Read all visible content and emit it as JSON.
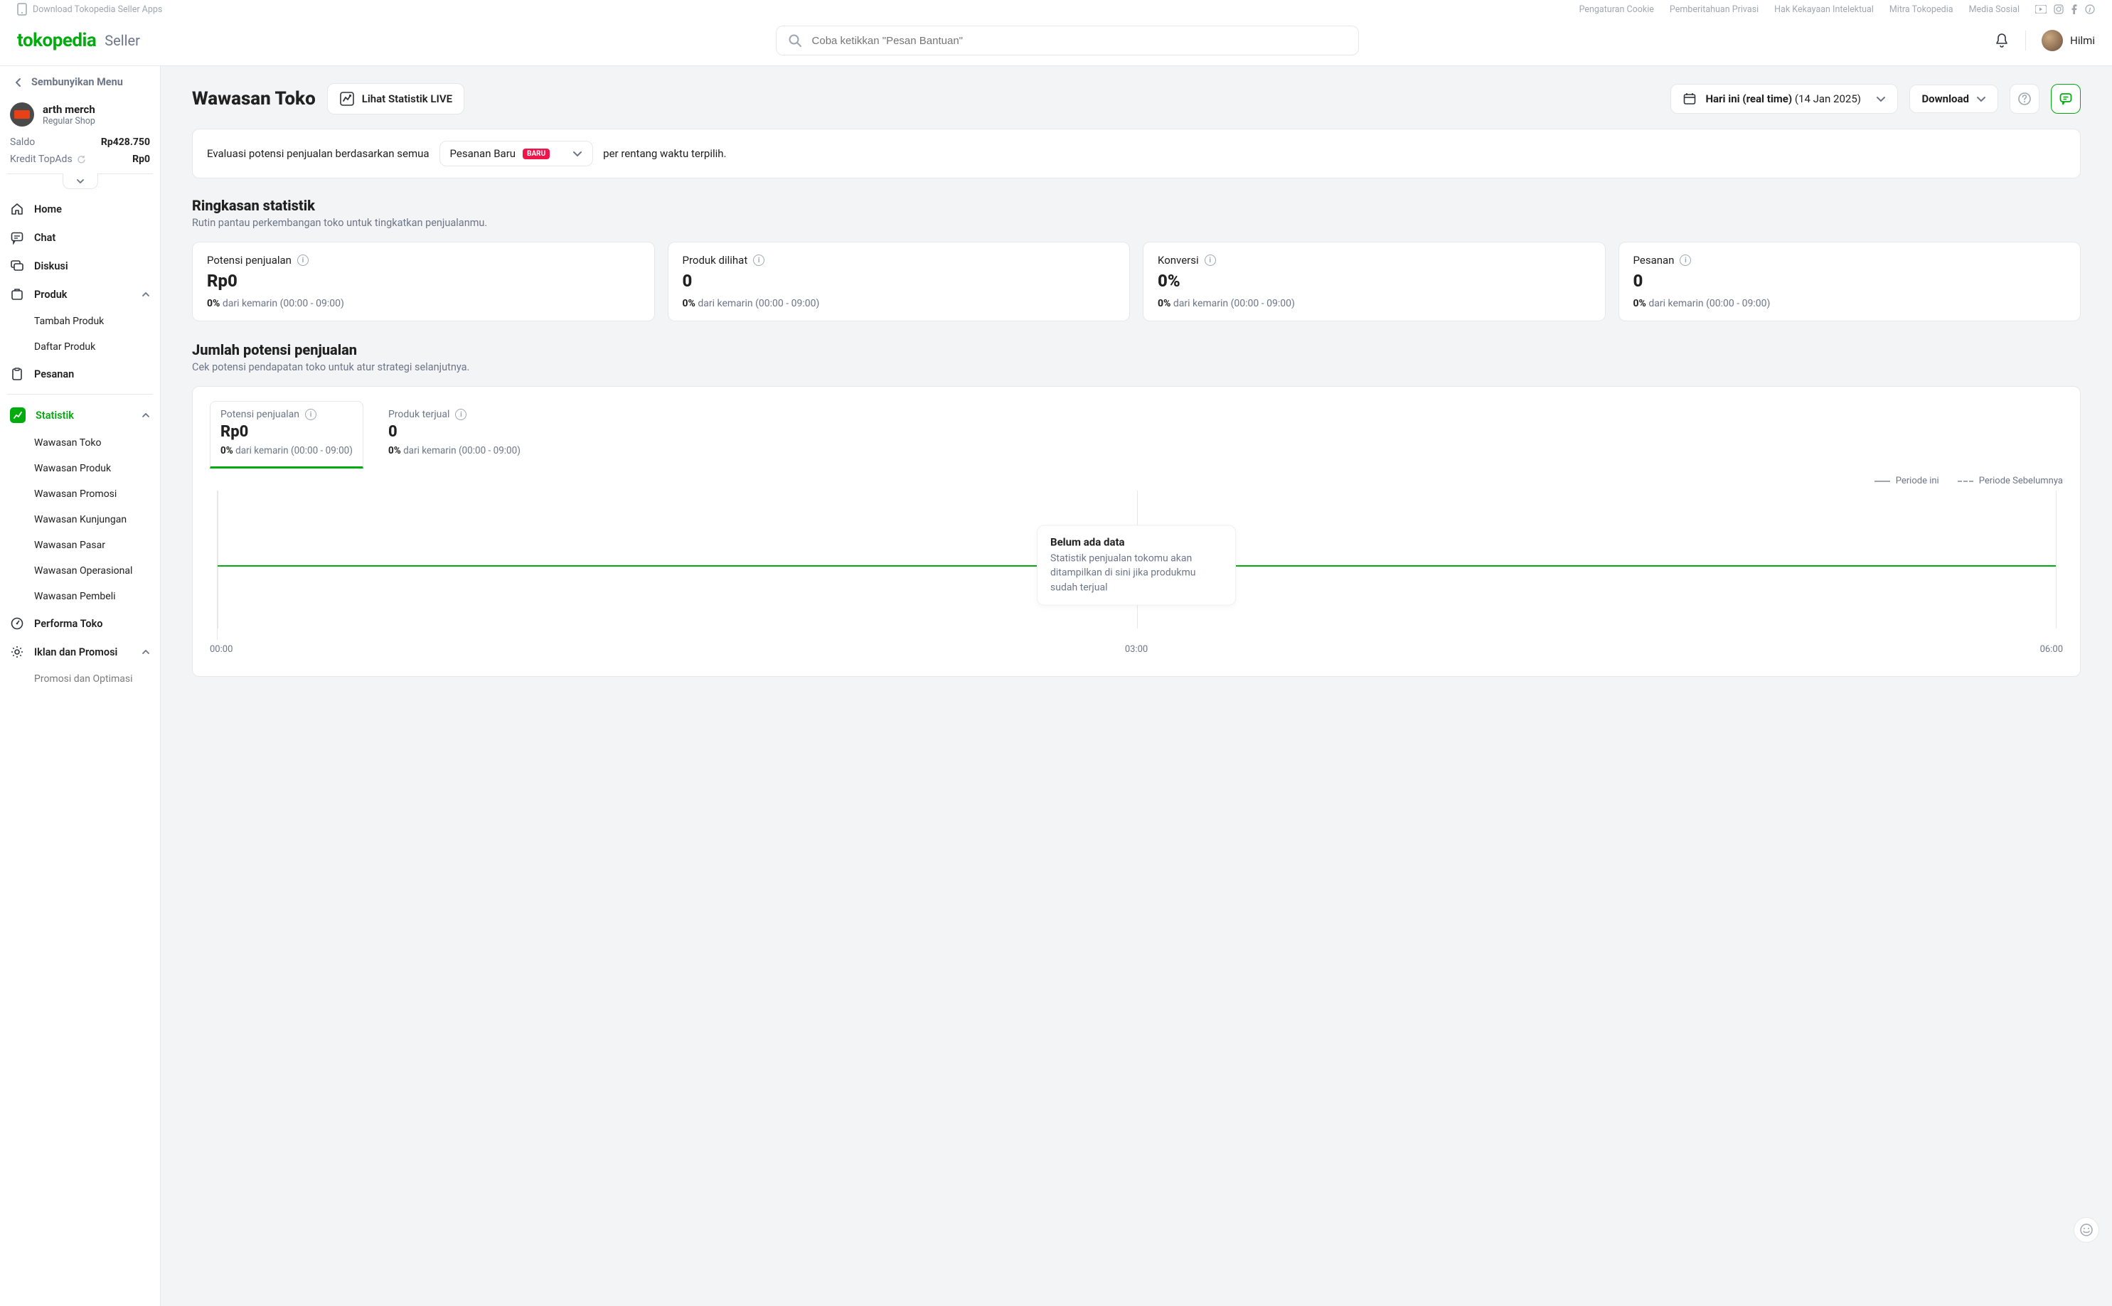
{
  "topbar": {
    "download": "Download Tokopedia Seller Apps",
    "links": [
      "Pengaturan Cookie",
      "Pemberitahuan Privasi",
      "Hak Kekayaan Intelektual",
      "Mitra Tokopedia",
      "Media Sosial"
    ]
  },
  "header": {
    "logo": "tokopedia",
    "logo_seller": "Seller",
    "search_placeholder": "Coba ketikkan \"Pesan Bantuan\"",
    "user_name": "Hilmi"
  },
  "sidebar": {
    "hide_menu": "Sembunyikan Menu",
    "shop_name": "arth merch",
    "shop_type": "Regular Shop",
    "saldo_label": "Saldo",
    "saldo_value": "Rp428.750",
    "kredit_label": "Kredit TopAds",
    "kredit_value": "Rp0",
    "items": {
      "home": "Home",
      "chat": "Chat",
      "diskusi": "Diskusi",
      "produk": "Produk",
      "tambah_produk": "Tambah Produk",
      "daftar_produk": "Daftar Produk",
      "pesanan": "Pesanan",
      "statistik": "Statistik",
      "wawasan_toko": "Wawasan Toko",
      "wawasan_produk": "Wawasan Produk",
      "wawasan_promosi": "Wawasan Promosi",
      "wawasan_kunjungan": "Wawasan Kunjungan",
      "wawasan_pasar": "Wawasan Pasar",
      "wawasan_operasional": "Wawasan Operasional",
      "wawasan_pembeli": "Wawasan Pembeli",
      "performa_toko": "Performa Toko",
      "iklan_promosi": "Iklan dan Promosi",
      "promosi_optimasi": "Promosi dan Optimasi"
    }
  },
  "page": {
    "title": "Wawasan Toko",
    "live_label": "Lihat Statistik LIVE",
    "date_prefix": "Hari ini (real time)",
    "date_value": "(14 Jan 2025)",
    "download": "Download",
    "eval": {
      "pre": "Evaluasi potensi penjualan berdasarkan semua",
      "select": "Pesanan Baru",
      "badge": "BARU",
      "post": "per rentang waktu terpilih."
    },
    "ringkasan": {
      "title": "Ringkasan statistik",
      "sub": "Rutin pantau perkembangan toko untuk tingkatkan penjualanmu.",
      "cards": [
        {
          "label": "Potensi penjualan",
          "value": "Rp0",
          "pct": "0%",
          "foot": "dari kemarin (00:00 - 09:00)"
        },
        {
          "label": "Produk dilihat",
          "value": "0",
          "pct": "0%",
          "foot": "dari kemarin (00:00 - 09:00)"
        },
        {
          "label": "Konversi",
          "value": "0%",
          "pct": "0%",
          "foot": "dari kemarin (00:00 - 09:00)"
        },
        {
          "label": "Pesanan",
          "value": "0",
          "pct": "0%",
          "foot": "dari kemarin (00:00 - 09:00)"
        }
      ]
    },
    "potensi": {
      "title": "Jumlah potensi penjualan",
      "sub": "Cek potensi pendapatan toko untuk atur strategi selanjutnya.",
      "tabs": [
        {
          "label": "Potensi penjualan",
          "value": "Rp0",
          "pct": "0%",
          "foot": "dari kemarin (00:00 - 09:00)"
        },
        {
          "label": "Produk terjual",
          "value": "0",
          "pct": "0%",
          "foot": "dari kemarin (00:00 - 09:00)"
        }
      ],
      "legend_this": "Periode ini",
      "legend_prev": "Periode Sebelumnya",
      "empty_title": "Belum ada data",
      "empty_desc": "Statistik penjualan tokomu akan ditampilkan di sini jika produkmu sudah terjual"
    }
  },
  "chart_data": {
    "type": "line",
    "title": "Jumlah potensi penjualan",
    "xlabel": "",
    "ylabel": "",
    "x": [
      "00:00",
      "03:00",
      "06:00"
    ],
    "series": [
      {
        "name": "Periode ini",
        "values": [
          0,
          0,
          0
        ]
      },
      {
        "name": "Periode Sebelumnya",
        "values": [
          0,
          0,
          0
        ]
      }
    ]
  }
}
